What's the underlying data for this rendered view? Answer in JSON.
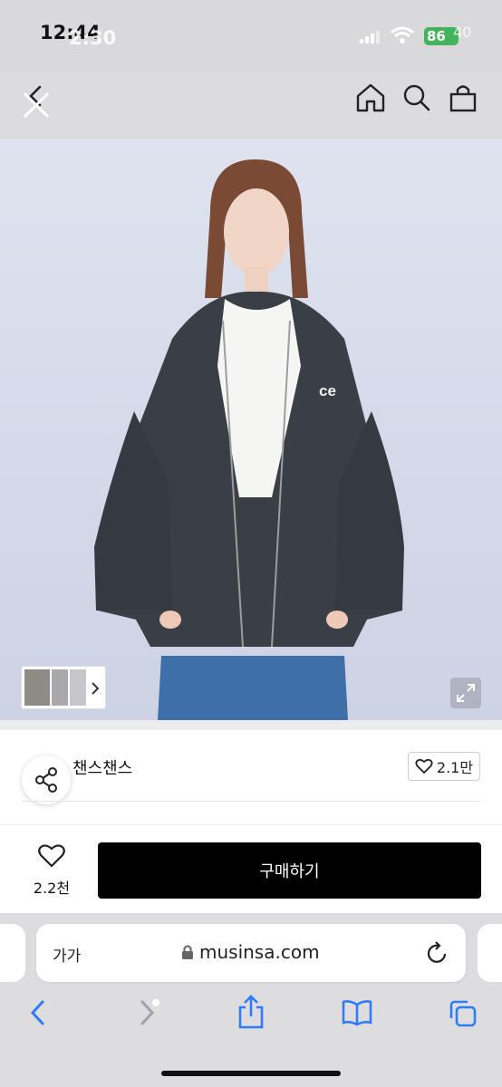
{
  "status_bar": {
    "time": "12:44",
    "time_overlay": "2:30",
    "battery": "86",
    "battery_overlay": "40"
  },
  "header": {
    "icons": [
      "back-icon",
      "close-icon",
      "home-icon",
      "search-icon",
      "cart-icon"
    ]
  },
  "product": {
    "image_alt": "hoodie-model-photo",
    "hoodie_logo": "ce"
  },
  "brand": {
    "name": "챈스챈스",
    "likes": "2.1만"
  },
  "purchase": {
    "fav_count": "2.2천",
    "buy_label": "구매하기"
  },
  "browser": {
    "text_size_label": "가가",
    "url": "musinsa.com"
  },
  "colors": {
    "buy_button": "#000000",
    "battery": "#43b35c",
    "safari_accent": "#2f7cf6"
  }
}
